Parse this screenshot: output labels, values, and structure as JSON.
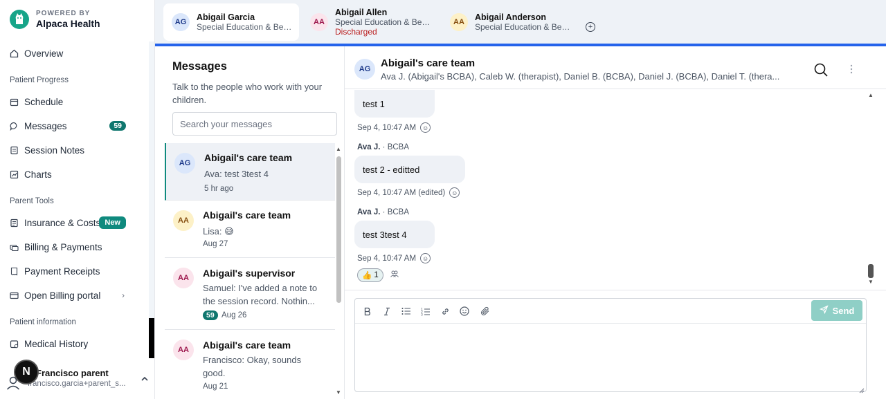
{
  "brand": {
    "powered": "POWERED BY",
    "name": "Alpaca Health",
    "color": "#17a589"
  },
  "sidebar": {
    "overview": "Overview",
    "section_progress": "Patient Progress",
    "schedule": "Schedule",
    "messages": "Messages",
    "messages_count": "59",
    "session_notes": "Session Notes",
    "charts": "Charts",
    "section_tools": "Parent Tools",
    "insurance": "Insurance & Costs",
    "insurance_badge": "New",
    "billing": "Billing & Payments",
    "receipts": "Payment Receipts",
    "billing_portal": "Open Billing portal",
    "section_info": "Patient information",
    "medical_history": "Medical History"
  },
  "user": {
    "badge": "N",
    "name": "Francisco parent",
    "email": "francisco.garcia+parent_s..."
  },
  "tabs": [
    {
      "initials": "AG",
      "name": "Abigail Garcia",
      "sub": "Special Education & Beh...",
      "status": ""
    },
    {
      "initials": "AA",
      "name": "Abigail Allen",
      "sub": "Special Education & Beh...",
      "status": "Discharged"
    },
    {
      "initials": "AA",
      "name": "Abigail Anderson",
      "sub": "Special Education & Beh...",
      "status": ""
    }
  ],
  "messages_pane": {
    "title": "Messages",
    "subtitle": "Talk to the people who work with your children.",
    "search_placeholder": "Search your messages"
  },
  "conversations": [
    {
      "initials": "AG",
      "title": "Abigail's care team",
      "preview": "Ava: test 3test 4",
      "time": "5 hr ago",
      "badge": ""
    },
    {
      "initials": "AA",
      "title": "Abigail's care team",
      "preview": "Lisa: 😅",
      "time": "Aug 27",
      "badge": ""
    },
    {
      "initials": "AA",
      "title": "Abigail's supervisor",
      "preview": "Samuel: I've added a note to the session record. Nothin...",
      "time": "Aug 26",
      "badge": "59"
    },
    {
      "initials": "AA",
      "title": "Abigail's care team",
      "preview": "Francisco: Okay, sounds good.",
      "time": "Aug 21",
      "badge": ""
    }
  ],
  "chat": {
    "initials": "AG",
    "title": "Abigail's care team",
    "members": "Ava J. (Abigail's BCBA), Caleb W. (therapist), Daniel B. (BCBA), Daniel J. (BCBA), Daniel T. (thera...",
    "messages": [
      {
        "sender": "",
        "role": "",
        "text": "test 1",
        "meta": "Sep 4, 10:47 AM"
      },
      {
        "sender": "Ava J.",
        "role": " · BCBA",
        "text": "test 2 - editted",
        "meta": "Sep 4, 10:47 AM (edited)"
      },
      {
        "sender": "Ava J.",
        "role": " · BCBA",
        "text": "test 3test 4",
        "meta": "Sep 4, 10:47 AM"
      }
    ],
    "reaction": {
      "emoji": "👍",
      "count": "1"
    },
    "send_label": "Send"
  }
}
